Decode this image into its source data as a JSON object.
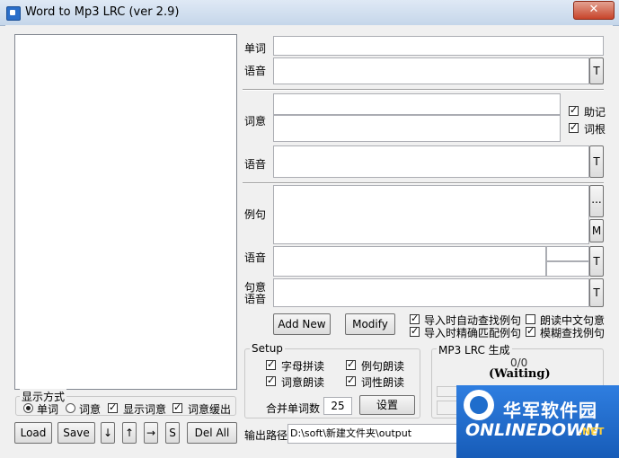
{
  "window": {
    "title": "Word to Mp3 LRC  (ver 2.9)",
    "close_glyph": "✕"
  },
  "fields": {
    "word_label": "单词",
    "phonetic_label": "语音",
    "meaning_label": "词意",
    "meaning_phonetic_label": "语音",
    "example_label": "例句",
    "example_phonetic_label": "语音",
    "sentence_meaning_label_1": "句意",
    "sentence_meaning_label_2": "语音",
    "t_button": "T",
    "ellipsis_button": "...",
    "m_button": "M",
    "mnemonic_label": "助记",
    "mnemonic_checked": true,
    "root_label": "词根",
    "root_checked": true
  },
  "actions": {
    "add_new": "Add New",
    "modify": "Modify",
    "option_auto_find": "导入时自动查找例句",
    "option_auto_find_checked": true,
    "option_read_cn": "朗读中文句意",
    "option_read_cn_checked": false,
    "option_exact_match": "导入时精确匹配例句",
    "option_exact_match_checked": true,
    "option_fuzzy": "模糊查找例句",
    "option_fuzzy_checked": true
  },
  "setup": {
    "title": "Setup",
    "spell": "字母拼读",
    "spell_checked": true,
    "read_example": "例句朗读",
    "read_example_checked": true,
    "read_meaning": "词意朗读",
    "read_meaning_checked": true,
    "read_pos": "词性朗读",
    "read_pos_checked": true,
    "merge_label": "合并单词数",
    "merge_value": "25",
    "settings_button": "设置"
  },
  "lrc": {
    "title": "MP3 LRC 生成",
    "progress": "0/0",
    "status": "(Waiting)"
  },
  "display_mode": {
    "title": "显示方式",
    "word": "单词",
    "word_selected": true,
    "meaning": "词意",
    "meaning_selected": false,
    "show_meaning": "显示词意",
    "show_meaning_checked": true,
    "meaning_buffer": "词意缓出",
    "meaning_buffer_checked": true
  },
  "bottom": {
    "load": "Load",
    "save": "Save",
    "down": "↓",
    "up": "↑",
    "right": "→",
    "s": "S",
    "del_all": "Del All",
    "output_label": "输出路径",
    "output_path": "D:\\soft\\新建文件夹\\output"
  },
  "watermark": {
    "cn": "华军软件园",
    "en": "ONLINEDOWN",
    "net": ".NET"
  }
}
